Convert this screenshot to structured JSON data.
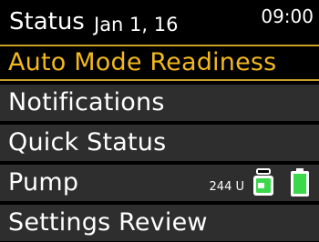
{
  "header": {
    "title": "Status",
    "date": "Jan 1, 16",
    "time": "09:00"
  },
  "menu": {
    "items": [
      {
        "label": "Auto Mode Readiness",
        "selected": true
      },
      {
        "label": "Notifications",
        "selected": false
      },
      {
        "label": "Quick Status",
        "selected": false
      },
      {
        "label": "Pump",
        "selected": false
      },
      {
        "label": "Settings Review",
        "selected": false
      }
    ]
  },
  "pump_status": {
    "insulin_units": "244 U",
    "reservoir_icon": "reservoir-icon",
    "battery_icon": "battery-icon"
  },
  "colors": {
    "selected_text": "#f2b81c",
    "selected_border": "#c9a227",
    "item_background": "#2e2e2e",
    "battery_fill": "#3ad84a",
    "reservoir_fill": "#3ad84a"
  }
}
